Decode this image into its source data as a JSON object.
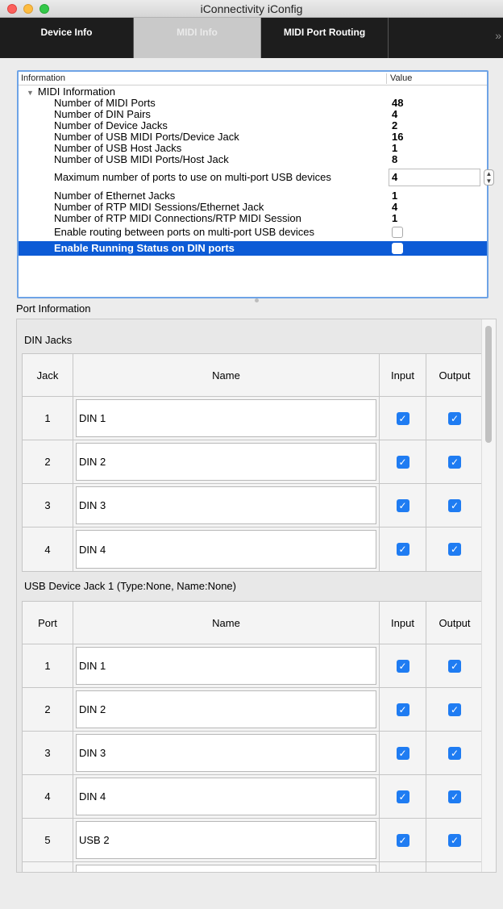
{
  "window": {
    "title": "iConnectivity iConfig"
  },
  "tabs": [
    {
      "label": "Device Info"
    },
    {
      "label": "MIDI Info"
    },
    {
      "label": "MIDI Port Routing"
    }
  ],
  "tab_overflow_glyph": "»",
  "info_table": {
    "col_information": "Information",
    "col_value": "Value",
    "group_label": "MIDI Information",
    "rows": [
      {
        "label": "Number of MIDI Ports",
        "value": "48"
      },
      {
        "label": "Number of DIN Pairs",
        "value": "4"
      },
      {
        "label": "Number of Device Jacks",
        "value": "2"
      },
      {
        "label": "Number of USB MIDI Ports/Device Jack",
        "value": "16"
      },
      {
        "label": "Number of USB Host Jacks",
        "value": "1"
      },
      {
        "label": "Number of USB MIDI Ports/Host Jack",
        "value": "8"
      },
      {
        "label": "Maximum number of ports to use on multi-port USB devices",
        "value": "4"
      },
      {
        "label": "Number of Ethernet Jacks",
        "value": "1"
      },
      {
        "label": "Number of RTP MIDI Sessions/Ethernet Jack",
        "value": "4"
      },
      {
        "label": "Number of RTP MIDI Connections/RTP MIDI Session",
        "value": "1"
      },
      {
        "label": "Enable routing between ports on multi-port USB devices",
        "checked": false
      },
      {
        "label": "Enable Running Status on DIN ports",
        "checked": false
      }
    ]
  },
  "port_info_label": "Port Information",
  "din_section": {
    "title": "DIN Jacks",
    "headers": {
      "id": "Jack",
      "name": "Name",
      "input": "Input",
      "output": "Output"
    },
    "rows": [
      {
        "id": "1",
        "name": "DIN 1",
        "input": true,
        "output": true
      },
      {
        "id": "2",
        "name": "DIN 2",
        "input": true,
        "output": true
      },
      {
        "id": "3",
        "name": "DIN 3",
        "input": true,
        "output": true
      },
      {
        "id": "4",
        "name": "DIN 4",
        "input": true,
        "output": true
      }
    ]
  },
  "usb_section": {
    "title": "USB Device Jack 1 (Type:None, Name:None)",
    "headers": {
      "id": "Port",
      "name": "Name",
      "input": "Input",
      "output": "Output"
    },
    "rows": [
      {
        "id": "1",
        "name": "DIN 1",
        "input": true,
        "output": true
      },
      {
        "id": "2",
        "name": "DIN 2",
        "input": true,
        "output": true
      },
      {
        "id": "3",
        "name": "DIN 3",
        "input": true,
        "output": true
      },
      {
        "id": "4",
        "name": "DIN 4",
        "input": true,
        "output": true
      },
      {
        "id": "5",
        "name": "USB 2",
        "input": true,
        "output": true
      }
    ]
  },
  "check_glyph": "✓",
  "colors": {
    "selection": "#0d5bd6",
    "checkbox": "#1f7cf2",
    "tabbar": "#1d1d1d",
    "active_tab": "#c9c9c9"
  }
}
